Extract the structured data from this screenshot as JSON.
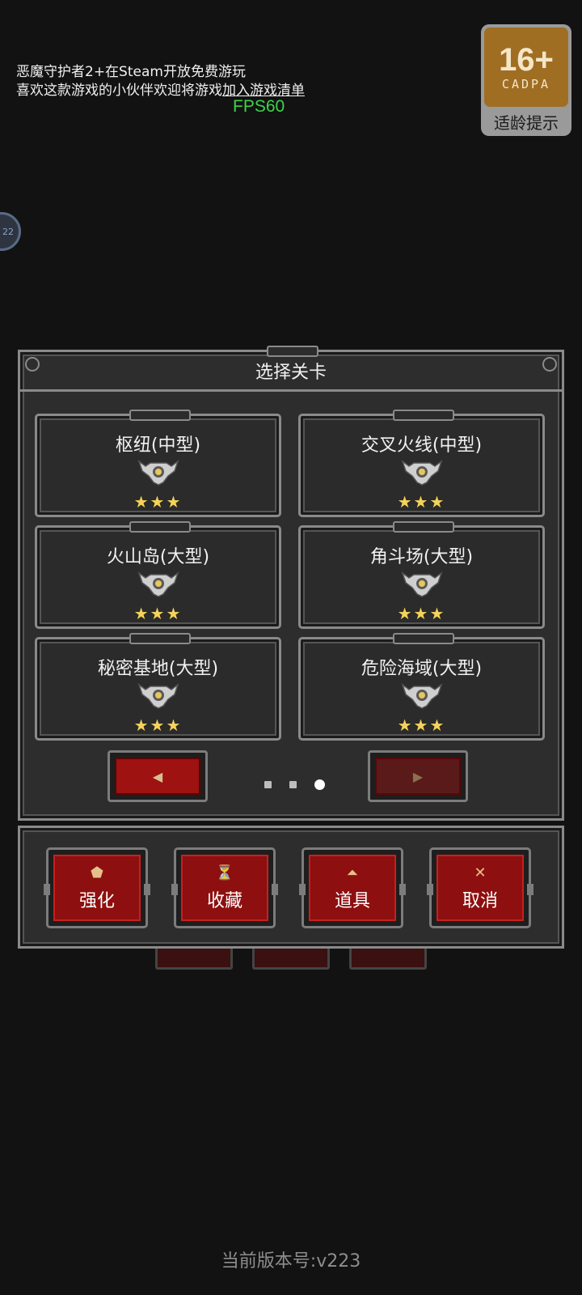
{
  "notice": {
    "line1": "恶魔守护者2+在Steam开放免费游玩",
    "line2_prefix": "喜欢这款游戏的小伙伴欢迎将游戏",
    "line2_link": "加入游戏清单"
  },
  "fps": "FPS60",
  "age_rating": {
    "age": "16+",
    "org": "CADPA",
    "tip": "适龄提示"
  },
  "side_bubble": "22",
  "dialog": {
    "title": "选择关卡",
    "levels": [
      {
        "name": "枢纽(中型)",
        "stars": "★★★",
        "star_count": 3
      },
      {
        "name": "交叉火线(中型)",
        "stars": "★★★",
        "star_count": 3
      },
      {
        "name": "火山岛(大型)",
        "stars": "★★★",
        "star_count": 3
      },
      {
        "name": "角斗场(大型)",
        "stars": "★★★",
        "star_count": 3
      },
      {
        "name": "秘密基地(大型)",
        "stars": "★★★",
        "star_count": 3
      },
      {
        "name": "危险海域(大型)",
        "stars": "★★★",
        "star_count": 3
      }
    ],
    "prev_icon": "◀",
    "next_icon": "▶",
    "page_indicator": {
      "current": 3,
      "total": 3
    }
  },
  "actions": [
    {
      "label": "强化",
      "icon": "upgrade-icon",
      "glyph": "⬟"
    },
    {
      "label": "收藏",
      "icon": "trophy-icon",
      "glyph": "⏳"
    },
    {
      "label": "道具",
      "icon": "potion-icon",
      "glyph": "⏶"
    },
    {
      "label": "取消",
      "icon": "close-icon",
      "glyph": "✕"
    }
  ],
  "version": "当前版本号:v223",
  "colors": {
    "accent_red": "#9e1212",
    "star": "#f5d35a",
    "fps_green": "#3fd24a",
    "badge_orange": "#a06e23"
  }
}
